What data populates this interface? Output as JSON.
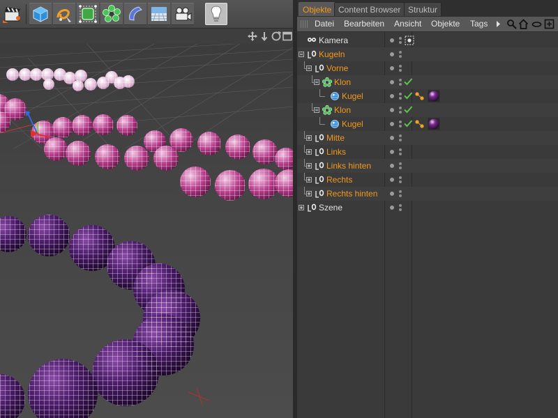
{
  "app": {
    "accent_color": "#f39a1e",
    "background_color": "#3a3a3a",
    "panel_text_color": "#e4e4e4"
  },
  "toolbar": {
    "buttons": [
      {
        "icon": "clapperboard-render-icon"
      },
      {
        "icon": "cube-primitive-icon"
      },
      {
        "icon": "spline-pen-icon"
      },
      {
        "icon": "subdivision-nurbs-icon"
      },
      {
        "icon": "mograph-cloner-icon"
      },
      {
        "icon": "deformer-bend-icon"
      },
      {
        "icon": "floor-scene-icon"
      },
      {
        "icon": "camera-icon"
      },
      {
        "icon": "light-bulb-icon"
      }
    ],
    "active_button": "light-bulb-icon"
  },
  "viewport": {
    "header_icons": [
      "move-view-icon",
      "zoom-view-icon",
      "rotate-view-icon",
      "maximize-view-icon"
    ]
  },
  "object_manager": {
    "tabs": [
      {
        "label": "Objekte",
        "active": true
      },
      {
        "label": "Content Browser",
        "active": false
      },
      {
        "label": "Struktur",
        "active": false
      }
    ],
    "menu": {
      "items": [
        "Datei",
        "Bearbeiten",
        "Ansicht",
        "Objekte",
        "Tags"
      ],
      "more_icon": "menu-more-arrow-icon",
      "tool_icons": [
        "search-icon",
        "home-icon",
        "hierarchy-oval-icon",
        "new-window-icon"
      ]
    },
    "tree": [
      {
        "label": "Kamera",
        "depth": 0,
        "icon": "camera-object-icon",
        "expander": "none",
        "color": "#e4e4e4",
        "checkmark": false,
        "tags": [
          "camera-target-tag-icon"
        ]
      },
      {
        "label": "Kugeln",
        "depth": 0,
        "icon": "null-object-icon",
        "expander": "minus",
        "color": "#f39a1e",
        "checkmark": false,
        "tags": []
      },
      {
        "label": "Vorne",
        "depth": 1,
        "icon": "null-object-icon",
        "expander": "minus",
        "color": "#f39a1e",
        "checkmark": false,
        "tags": []
      },
      {
        "label": "Klon",
        "depth": 2,
        "icon": "cloner-object-icon",
        "expander": "minus",
        "color": "#f39a1e",
        "checkmark": true,
        "tags": []
      },
      {
        "label": "Kugel",
        "depth": 3,
        "icon": "sphere-object-icon",
        "expander": "none",
        "color": "#f39a1e",
        "checkmark": true,
        "tags": [
          "phong-tag-icon",
          "material-tag-icon"
        ]
      },
      {
        "label": "Klon",
        "depth": 2,
        "icon": "cloner-object-icon",
        "expander": "minus",
        "color": "#f39a1e",
        "checkmark": true,
        "tags": []
      },
      {
        "label": "Kugel",
        "depth": 3,
        "icon": "sphere-object-icon",
        "expander": "none",
        "color": "#f39a1e",
        "checkmark": true,
        "tags": [
          "phong-tag-icon",
          "material-tag-icon"
        ]
      },
      {
        "label": "Mitte",
        "depth": 1,
        "icon": "null-object-icon",
        "expander": "plus",
        "color": "#f39a1e",
        "checkmark": false,
        "tags": []
      },
      {
        "label": "Links",
        "depth": 1,
        "icon": "null-object-icon",
        "expander": "plus",
        "color": "#f39a1e",
        "checkmark": false,
        "tags": []
      },
      {
        "label": "Links hinten",
        "depth": 1,
        "icon": "null-object-icon",
        "expander": "plus",
        "color": "#f39a1e",
        "checkmark": false,
        "tags": []
      },
      {
        "label": "Rechts",
        "depth": 1,
        "icon": "null-object-icon",
        "expander": "plus",
        "color": "#f39a1e",
        "checkmark": false,
        "tags": []
      },
      {
        "label": "Rechts hinten",
        "depth": 1,
        "icon": "null-object-icon",
        "expander": "plus",
        "color": "#f39a1e",
        "checkmark": false,
        "tags": []
      },
      {
        "label": "Szene",
        "depth": 0,
        "icon": "null-object-icon",
        "expander": "plus",
        "color": "#e4e4e4",
        "checkmark": false,
        "tags": []
      }
    ]
  }
}
